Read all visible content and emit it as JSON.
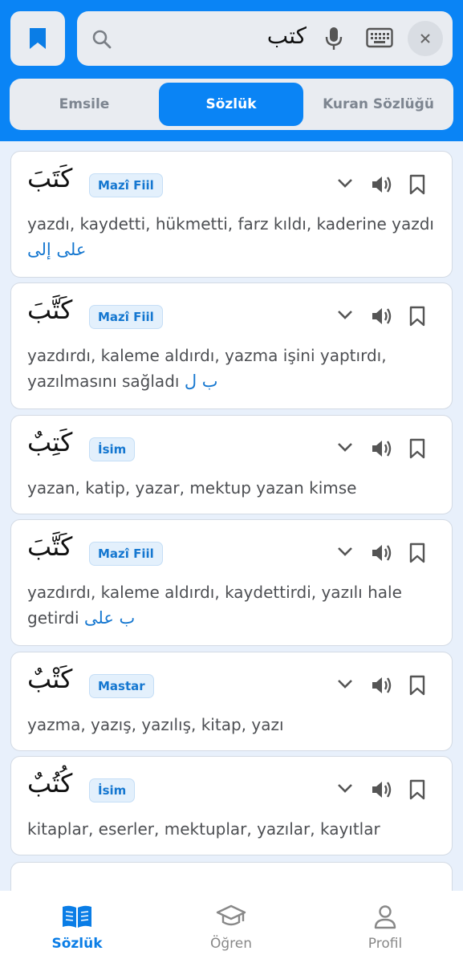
{
  "search": {
    "value": "كتب"
  },
  "tabs": [
    {
      "label": "Emsile"
    },
    {
      "label": "Sözlük"
    },
    {
      "label": "Kuran Sözlüğü"
    }
  ],
  "entries": [
    {
      "word": "كَتَبَ",
      "type": "Mazî Fiil",
      "meaning": "yazdı, kaydetti, hükmetti, farz kıldı, kaderine yazdı",
      "prep": "على إلى"
    },
    {
      "word": "كَتَّبَ",
      "type": "Mazî Fiil",
      "meaning": "yazdırdı, kaleme aldırdı, yazma işini yaptırdı, yazılmasını sağladı",
      "prep": "ب ل"
    },
    {
      "word": "كَتِبٌ",
      "type": "İsim",
      "meaning": "yazan, katip, yazar, mektup yazan kimse",
      "prep": ""
    },
    {
      "word": "كَتَّبَ",
      "type": "Mazî Fiil",
      "meaning": "yazdırdı, kaleme aldırdı, kaydettirdi, yazılı hale getirdi",
      "prep": "ب على"
    },
    {
      "word": "كَتْبٌ",
      "type": "Mastar",
      "meaning": "yazma, yazış, yazılış, kitap, yazı",
      "prep": ""
    },
    {
      "word": "كُتُبٌ",
      "type": "İsim",
      "meaning": "kitaplar, eserler, mektuplar, yazılar, kayıtlar",
      "prep": ""
    }
  ],
  "nav": [
    {
      "label": "Sözlük"
    },
    {
      "label": "Öğren"
    },
    {
      "label": "Profil"
    }
  ],
  "colors": {
    "primary": "#0a84f5",
    "badge_text": "#1577d0"
  }
}
